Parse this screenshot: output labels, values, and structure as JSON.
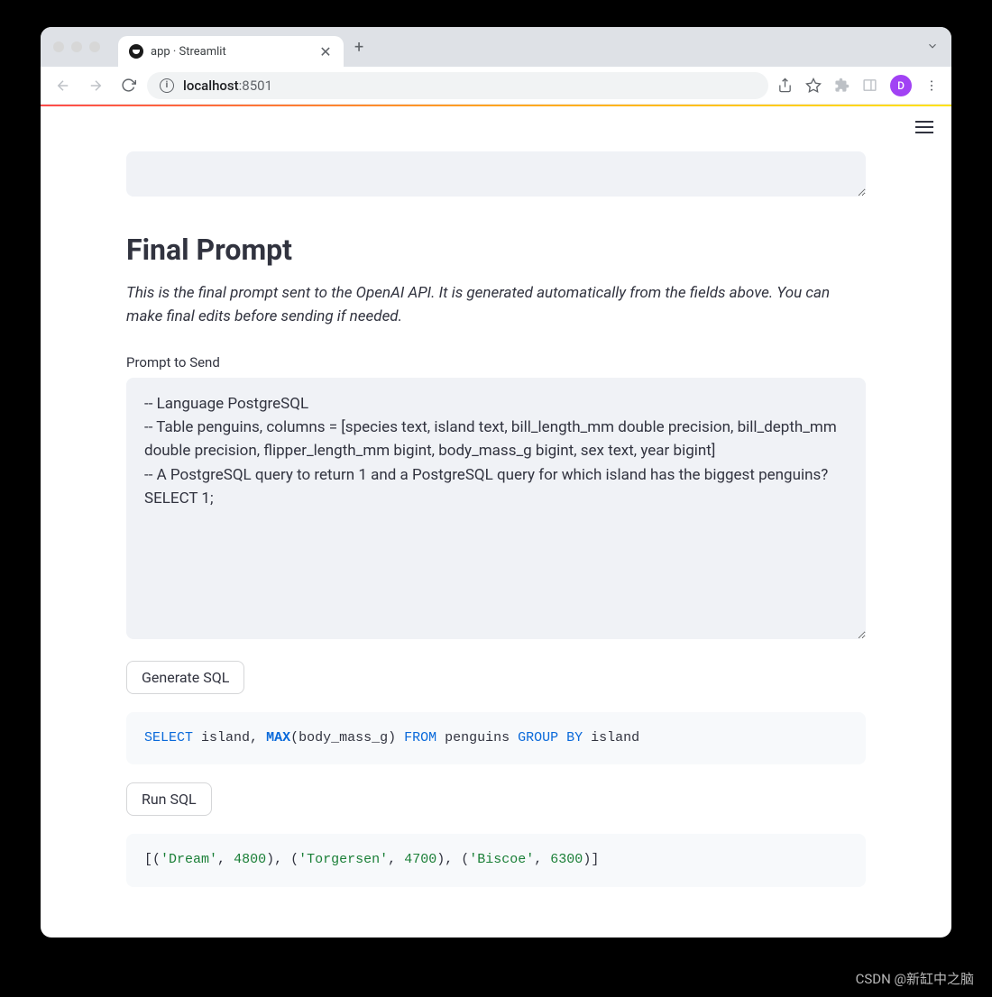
{
  "browser": {
    "tab_title": "app · Streamlit",
    "url_host": "localhost",
    "url_path": ":8501",
    "avatar_letter": "D"
  },
  "page": {
    "heading": "Final Prompt",
    "description": "This is the final prompt sent to the OpenAI API. It is generated automatically from the fields above. You can make final edits before sending if needed.",
    "prompt_label": "Prompt to Send",
    "prompt_value": "-- Language PostgreSQL\n-- Table penguins, columns = [species text, island text, bill_length_mm double precision, bill_depth_mm double precision, flipper_length_mm bigint, body_mass_g bigint, sex text, year bigint]\n-- A PostgreSQL query to return 1 and a PostgreSQL query for which island has the biggest penguins?\nSELECT 1;",
    "generate_btn": "Generate SQL",
    "run_btn": "Run SQL",
    "sql_output": {
      "tokens": [
        {
          "t": "SELECT",
          "c": "kw"
        },
        {
          "t": " island",
          "c": "punct"
        },
        {
          "t": ",",
          "c": "punct"
        },
        {
          "t": " ",
          "c": "punct"
        },
        {
          "t": "MAX",
          "c": "fn"
        },
        {
          "t": "(body_mass_g)",
          "c": "punct"
        },
        {
          "t": " ",
          "c": "punct"
        },
        {
          "t": "FROM",
          "c": "kw"
        },
        {
          "t": " penguins ",
          "c": "punct"
        },
        {
          "t": "GROUP BY",
          "c": "kw"
        },
        {
          "t": " island",
          "c": "punct"
        }
      ]
    },
    "result_output": {
      "tokens": [
        {
          "t": "[(",
          "c": "punct"
        },
        {
          "t": "'Dream'",
          "c": "str"
        },
        {
          "t": ",",
          "c": "punct"
        },
        {
          "t": " ",
          "c": "punct"
        },
        {
          "t": "4800",
          "c": "num"
        },
        {
          "t": ")",
          "c": "punct"
        },
        {
          "t": ",",
          "c": "punct"
        },
        {
          "t": " (",
          "c": "punct"
        },
        {
          "t": "'Torgersen'",
          "c": "str"
        },
        {
          "t": ",",
          "c": "punct"
        },
        {
          "t": " ",
          "c": "punct"
        },
        {
          "t": "4700",
          "c": "num"
        },
        {
          "t": ")",
          "c": "punct"
        },
        {
          "t": ",",
          "c": "punct"
        },
        {
          "t": " (",
          "c": "punct"
        },
        {
          "t": "'Biscoe'",
          "c": "str"
        },
        {
          "t": ",",
          "c": "punct"
        },
        {
          "t": " ",
          "c": "punct"
        },
        {
          "t": "6300",
          "c": "num"
        },
        {
          "t": ")]",
          "c": "punct"
        }
      ]
    }
  },
  "watermark": "CSDN @新缸中之脑"
}
